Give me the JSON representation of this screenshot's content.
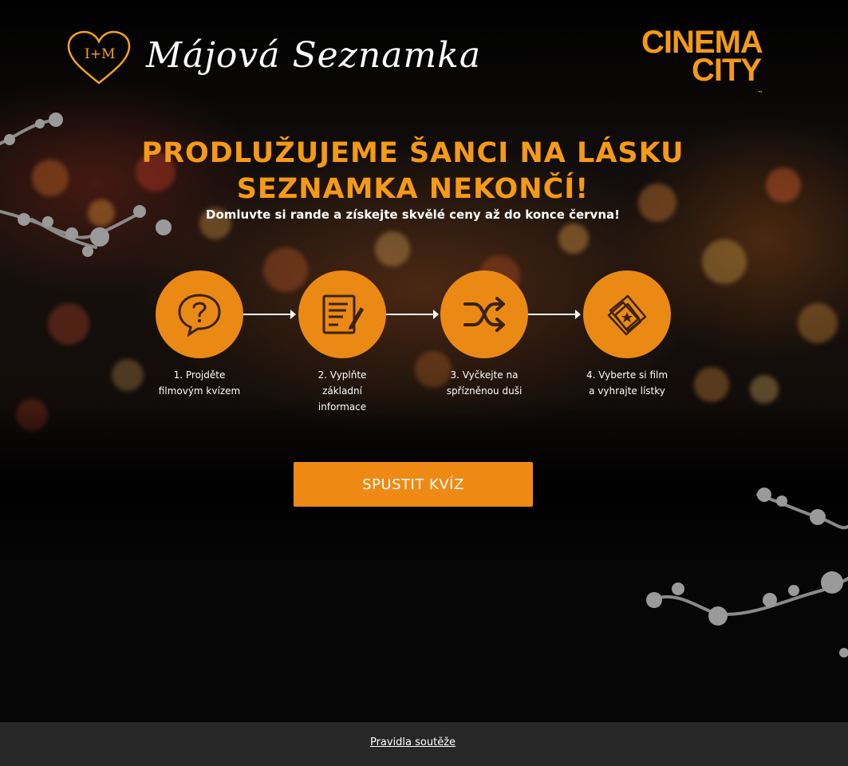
{
  "header": {
    "logo_monogram": "I+M",
    "logo_title": "Májová Seznamka",
    "brand_line1": "CINEMA",
    "brand_line2": "CITY",
    "brand_tm": "™"
  },
  "hero": {
    "headline_line1": "PRODLUŽUJEME ŠANCI NA LÁSKU",
    "headline_line2": "SEZNAMKA NEKONČÍ!",
    "subtitle": "Domluvte si rande a získejte skvělé ceny až do konce června!"
  },
  "steps": [
    {
      "icon": "question-bubble-icon",
      "line1": "1. Projděte",
      "line2": "filmovým kvízem",
      "line3": ""
    },
    {
      "icon": "form-pencil-icon",
      "line1": "2. Vyplňte",
      "line2": "základní",
      "line3": "informace"
    },
    {
      "icon": "shuffle-icon",
      "line1": "3. Vyčkejte na",
      "line2": "spřízněnou duši",
      "line3": ""
    },
    {
      "icon": "movie-tickets-icon",
      "line1": "4. Vyberte si film",
      "line2": "a vyhrajte lístky",
      "line3": ""
    }
  ],
  "cta": {
    "label": "SPUSTIT KVÍZ"
  },
  "footer": {
    "rules_link": "Pravidla soutěže"
  },
  "colors": {
    "accent": "#f59a16",
    "button": "#ee8a14",
    "footer_bg": "#272727"
  }
}
